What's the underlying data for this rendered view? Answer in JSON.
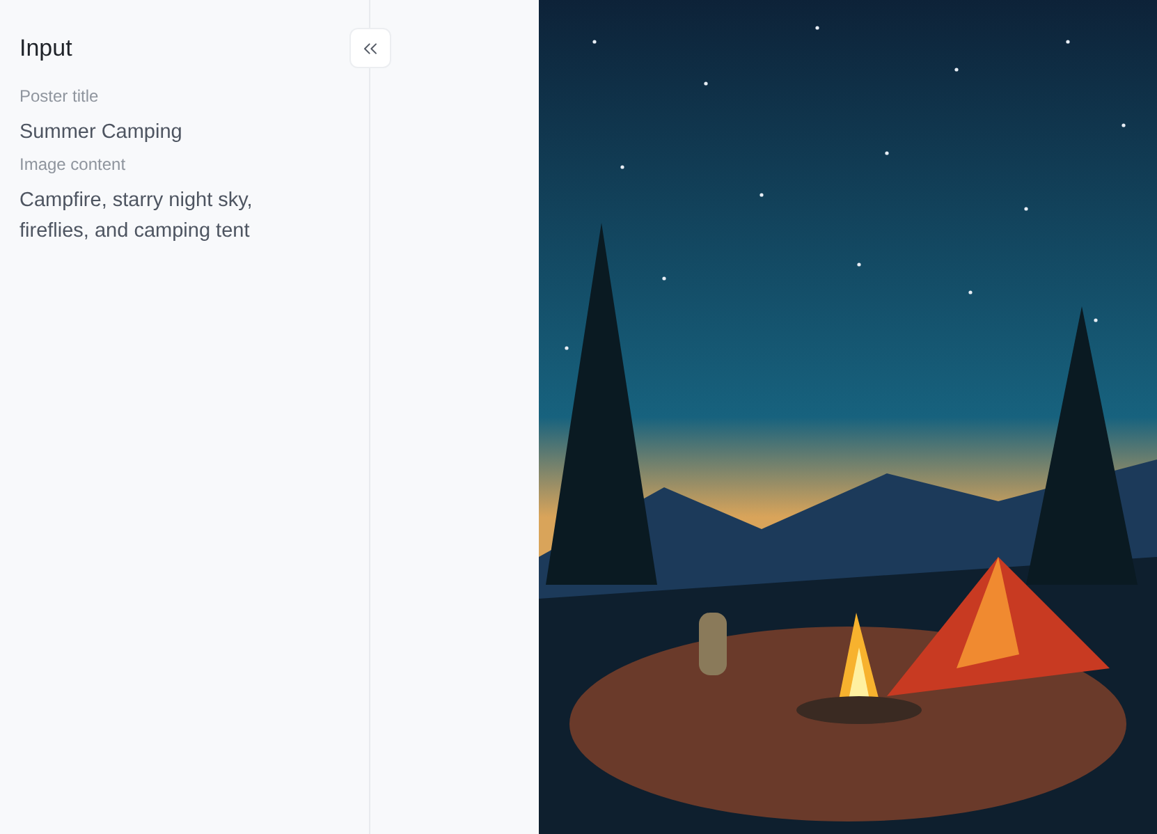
{
  "panel": {
    "title": "Input",
    "fields": [
      {
        "label": "Poster title",
        "value": "Summer Camping"
      },
      {
        "label": "Image content",
        "value": "Campfire, starry night sky, fireflies, and camping tent"
      }
    ]
  }
}
